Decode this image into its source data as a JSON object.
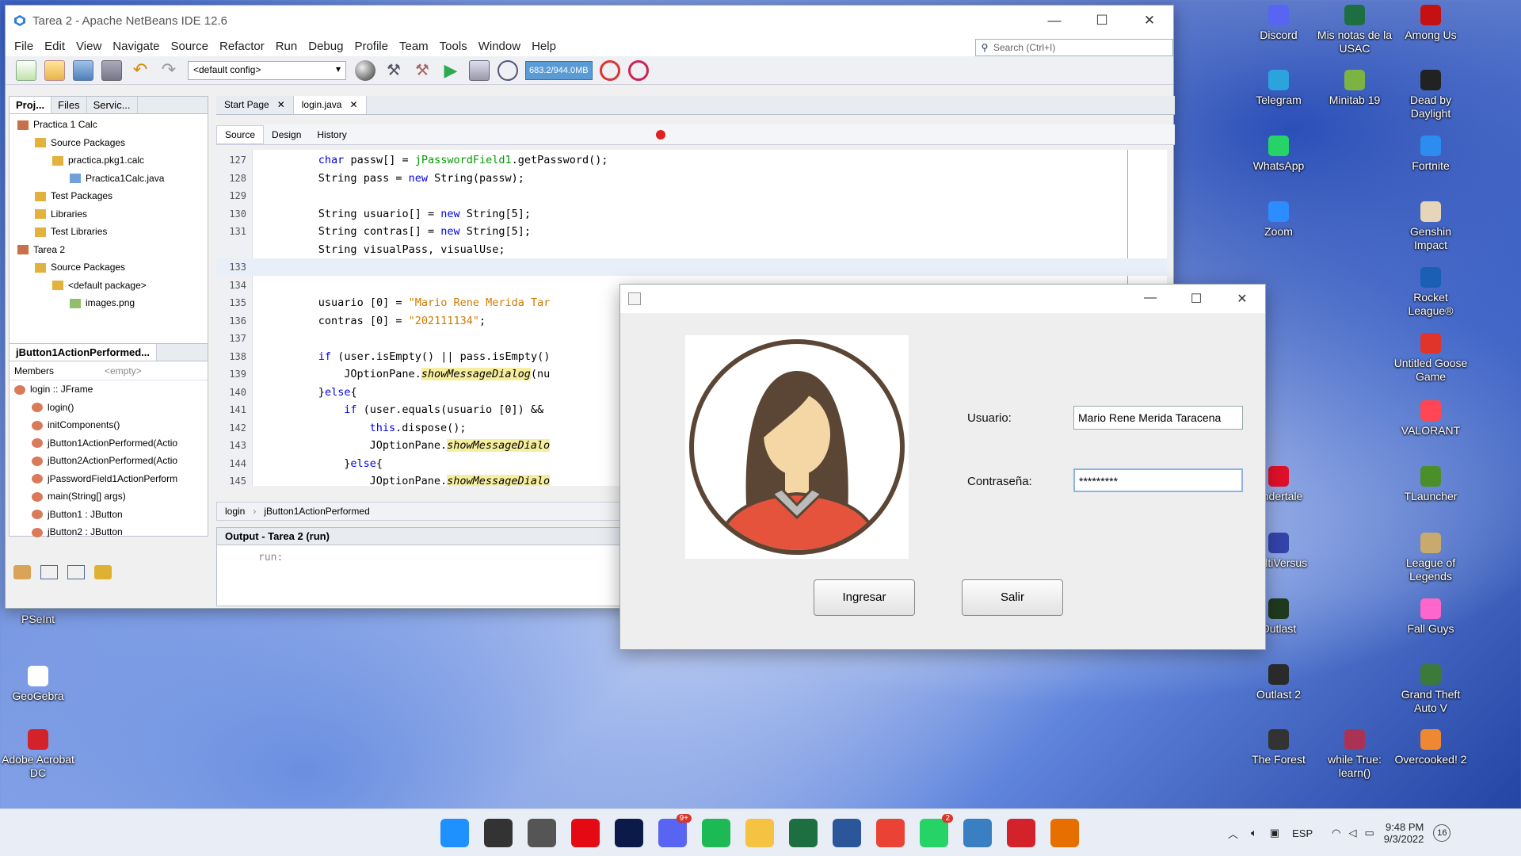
{
  "desktop": {
    "left_icons": [
      {
        "label": "PSeInt",
        "name": "pseint-icon",
        "color": "#2266aa"
      },
      {
        "label": "GeoGebra",
        "name": "geogebra-icon",
        "color": "#ffffff"
      },
      {
        "label": "Adobe Acrobat DC",
        "name": "acrobat-icon",
        "color": "#d4222a"
      }
    ],
    "right_icons": [
      {
        "label": "Discord",
        "name": "discord-icon",
        "color": "#5865f2"
      },
      {
        "label": "Mis notas de la USAC",
        "name": "excel-icon",
        "color": "#1d6f42"
      },
      {
        "label": "Among Us",
        "name": "among-us-icon",
        "color": "#c51111"
      },
      {
        "label": "Telegram",
        "name": "telegram-icon",
        "color": "#2aa3de"
      },
      {
        "label": "Minitab 19",
        "name": "minitab-icon",
        "color": "#7cb342"
      },
      {
        "label": "Dead by Daylight",
        "name": "dbd-icon",
        "color": "#222222"
      },
      {
        "label": "WhatsApp",
        "name": "whatsapp-icon",
        "color": "#25d366"
      },
      {
        "label": "Fortnite",
        "name": "fortnite-icon",
        "color": "#2d8cf0"
      },
      {
        "label": "Zoom",
        "name": "zoom-icon",
        "color": "#2d8cff"
      },
      {
        "label": "Genshin Impact",
        "name": "genshin-icon",
        "color": "#e6d5b8"
      },
      {
        "label": "Rocket League®",
        "name": "rocket-league-icon",
        "color": "#1a5fb4"
      },
      {
        "label": "Untitled Goose Game",
        "name": "goose-icon",
        "color": "#e0332a"
      },
      {
        "label": "VALORANT",
        "name": "valorant-icon",
        "color": "#ff4655"
      },
      {
        "label": "Undertale",
        "name": "undertale-icon",
        "color": "#e0102a"
      },
      {
        "label": "TLauncher",
        "name": "tlauncher-icon",
        "color": "#4a8f2a"
      },
      {
        "label": "MultiVersus",
        "name": "multiversus-icon",
        "color": "#3344aa"
      },
      {
        "label": "League of Legends",
        "name": "lol-icon",
        "color": "#c8aa6e"
      },
      {
        "label": "Outlast",
        "name": "outlast-icon",
        "color": "#1f3a1f"
      },
      {
        "label": "Fall Guys",
        "name": "fall-guys-icon",
        "color": "#ff66cc"
      },
      {
        "label": "Outlast 2",
        "name": "outlast2-icon",
        "color": "#2a2a2a"
      },
      {
        "label": "Grand Theft Auto V",
        "name": "gta-icon",
        "color": "#3a7a3a"
      },
      {
        "label": "The Forest",
        "name": "forest-icon",
        "color": "#333333"
      },
      {
        "label": "while True: learn()",
        "name": "while-true-icon",
        "color": "#aa3355"
      },
      {
        "label": "Overcooked! 2",
        "name": "overcooked-icon",
        "color": "#ee8833"
      }
    ]
  },
  "netbeans": {
    "title": "Tarea 2 - Apache NetBeans IDE 12.6",
    "menu": [
      "File",
      "Edit",
      "View",
      "Navigate",
      "Source",
      "Refactor",
      "Run",
      "Debug",
      "Profile",
      "Team",
      "Tools",
      "Window",
      "Help"
    ],
    "search_placeholder": "Search (Ctrl+I)",
    "config": "<default config>",
    "memory": "683.2/944.0MB",
    "project_tabs": [
      "Proj...",
      "Files",
      "Servic..."
    ],
    "project_tree": [
      {
        "label": "Practica 1 Calc",
        "indent": 0,
        "type": "project"
      },
      {
        "label": "Source Packages",
        "indent": 1,
        "type": "folder"
      },
      {
        "label": "practica.pkg1.calc",
        "indent": 2,
        "type": "package"
      },
      {
        "label": "Practica1Calc.java",
        "indent": 3,
        "type": "java"
      },
      {
        "label": "Test Packages",
        "indent": 1,
        "type": "folder"
      },
      {
        "label": "Libraries",
        "indent": 1,
        "type": "folder"
      },
      {
        "label": "Test Libraries",
        "indent": 1,
        "type": "folder"
      },
      {
        "label": "Tarea 2",
        "indent": 0,
        "type": "project"
      },
      {
        "label": "Source Packages",
        "indent": 1,
        "type": "folder"
      },
      {
        "label": "<default package>",
        "indent": 2,
        "type": "package"
      },
      {
        "label": "images.png",
        "indent": 3,
        "type": "image"
      }
    ],
    "navigator_title": "jButton1ActionPerformed...",
    "navigator_filter": "Members",
    "navigator_empty": "<empty>",
    "navigator_items": [
      {
        "label": "login :: JFrame",
        "indent": 0
      },
      {
        "label": "login()",
        "indent": 1
      },
      {
        "label": "initComponents()",
        "indent": 1
      },
      {
        "label": "jButton1ActionPerformed(Actio",
        "indent": 1
      },
      {
        "label": "jButton2ActionPerformed(Actio",
        "indent": 1
      },
      {
        "label": "jPasswordField1ActionPerform",
        "indent": 1
      },
      {
        "label": "main(String[] args)",
        "indent": 1
      },
      {
        "label": "jButton1 : JButton",
        "indent": 1
      },
      {
        "label": "jButton2 : JButton",
        "indent": 1
      }
    ],
    "editor_tabs": [
      "Start Page",
      "login.java"
    ],
    "editor_modes": [
      "Source",
      "Design",
      "History"
    ],
    "code_lines": [
      {
        "n": "127",
        "html": "<span class='k'>char</span> passw[] = <span class='f'>jPasswordField1</span>.getPassword();",
        "indent": 8
      },
      {
        "n": "128",
        "html": "String pass = <span class='k'>new</span> String(passw);",
        "indent": 8
      },
      {
        "n": "129",
        "html": "",
        "indent": 8
      },
      {
        "n": "130",
        "html": "String usuario[] = <span class='k'>new</span> String[5];",
        "indent": 8
      },
      {
        "n": "131",
        "html": "String contras[] = <span class='k'>new</span> String[5];",
        "indent": 8
      },
      {
        "n": "",
        "html": "String visualPass, visualUse;",
        "indent": 8
      },
      {
        "n": "133",
        "html": "",
        "indent": 8
      },
      {
        "n": "134",
        "html": "",
        "indent": 8
      },
      {
        "n": "135",
        "html": "usuario [0] = <span class='s'>\"Mario Rene Merida Tar</span>",
        "indent": 8
      },
      {
        "n": "136",
        "html": "contras [0] = <span class='s'>\"202111134\"</span>;",
        "indent": 8
      },
      {
        "n": "137",
        "html": "",
        "indent": 8
      },
      {
        "n": "138",
        "html": "<span class='k'>if</span> (user.isEmpty() || pass.isEmpty()",
        "indent": 8
      },
      {
        "n": "139",
        "html": "JOptionPane.<span class='it'>showMessageDialog</span>(nu",
        "indent": 12
      },
      {
        "n": "140",
        "html": "}<span class='k'>else</span>{",
        "indent": 8
      },
      {
        "n": "141",
        "html": "<span class='k'>if</span> (user.equals(usuario [0]) &amp;&amp;",
        "indent": 12
      },
      {
        "n": "142",
        "html": "<span class='k'>this</span>.dispose();",
        "indent": 16
      },
      {
        "n": "143",
        "html": "JOptionPane.<span class='it'>showMessageDialo</span>",
        "indent": 16
      },
      {
        "n": "144",
        "html": "}<span class='k'>else</span>{",
        "indent": 12
      },
      {
        "n": "145",
        "html": "JOptionPane.<span class='it'>showMessageDialo</span>",
        "indent": 16
      }
    ],
    "breadcrumb": [
      "login",
      "jButton1ActionPerformed"
    ],
    "output_title": "Output - Tarea 2 (run)",
    "output_text": "run:"
  },
  "login": {
    "usuario_label": "Usuario:",
    "usuario_value": "Mario Rene Merida Taracena",
    "password_label": "Contraseña:",
    "password_value": "*********",
    "ingresar": "Ingresar",
    "salir": "Salir"
  },
  "taskbar": {
    "apps": [
      {
        "name": "start-icon",
        "color": "#1e90ff"
      },
      {
        "name": "search-icon",
        "color": "#333333"
      },
      {
        "name": "settings-icon",
        "color": "#555555"
      },
      {
        "name": "netflix-icon",
        "color": "#e50914"
      },
      {
        "name": "disney-plus-icon",
        "color": "#0c1a4a"
      },
      {
        "name": "discord-taskbar-icon",
        "color": "#5865f2",
        "badge": "9+"
      },
      {
        "name": "spotify-icon",
        "color": "#1db954"
      },
      {
        "name": "file-explorer-icon",
        "color": "#f5c242"
      },
      {
        "name": "excel-taskbar-icon",
        "color": "#1d6f42"
      },
      {
        "name": "word-icon",
        "color": "#2b579a"
      },
      {
        "name": "chrome-icon",
        "color": "#ea4335"
      },
      {
        "name": "whatsapp-taskbar-icon",
        "color": "#25d366",
        "badge": "2"
      },
      {
        "name": "netbeans-taskbar-icon",
        "color": "#3a7fc1"
      },
      {
        "name": "acrobat-taskbar-icon",
        "color": "#d4222a"
      },
      {
        "name": "java-app-icon",
        "color": "#e76f00"
      }
    ],
    "lang": "ESP",
    "time": "9:48 PM",
    "date": "9/3/2022",
    "notif": "16"
  }
}
